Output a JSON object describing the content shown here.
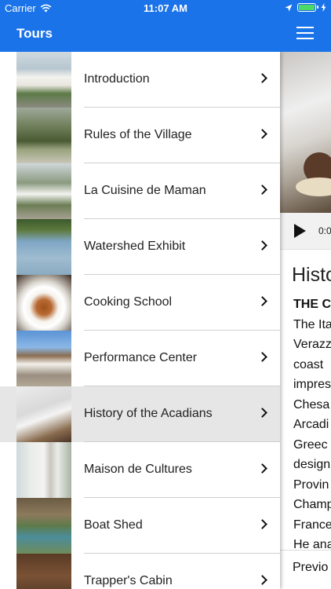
{
  "status_bar": {
    "carrier": "Carrier",
    "time": "11:07 AM",
    "battery_level": 1.0
  },
  "nav": {
    "title": "Tours",
    "menu_icon": "hamburger-icon"
  },
  "menu": {
    "items": [
      {
        "label": "Introduction"
      },
      {
        "label": "Rules of the Village"
      },
      {
        "label": "La Cuisine de Maman"
      },
      {
        "label": "Watershed Exhibit"
      },
      {
        "label": "Cooking School"
      },
      {
        "label": "Performance Center"
      },
      {
        "label": "History of the Acadians",
        "selected": true
      },
      {
        "label": "Maison de Cultures"
      },
      {
        "label": "Boat Shed"
      },
      {
        "label": "Trapper's Cabin"
      }
    ]
  },
  "detail": {
    "player_time": "0:0",
    "heading": "Histo",
    "body_lines": [
      "THE C",
      "The Ita",
      "Verazz",
      "coast",
      "impres",
      "Chesa",
      "Arcadi",
      "Greec",
      "design",
      "Provin",
      "Champ",
      "France",
      "He ana"
    ],
    "previous_label": "Previo"
  },
  "colors": {
    "accent": "#1a73e8",
    "selected_row": "#e6e6e6",
    "battery": "#4cd964"
  }
}
